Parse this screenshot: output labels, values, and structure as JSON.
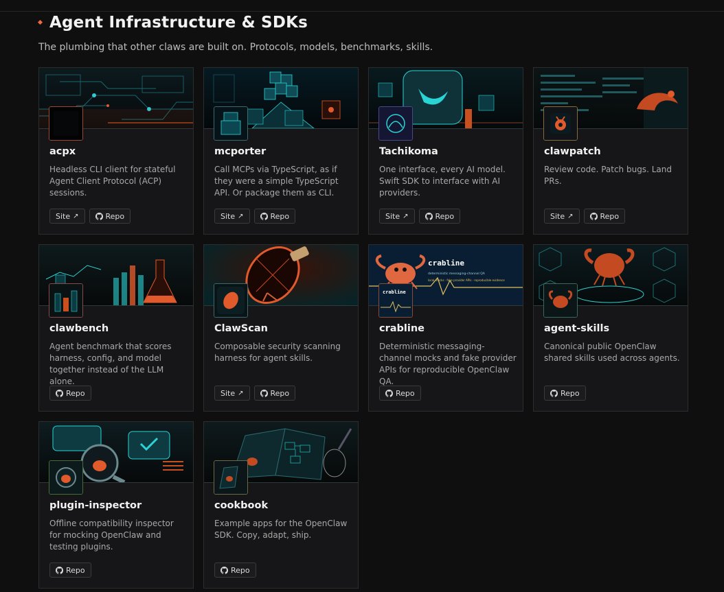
{
  "section": {
    "title": "Agent Infrastructure & SDKs",
    "subtitle": "The plumbing that other claws are built on. Protocols, models, benchmarks, skills."
  },
  "labels": {
    "site": "Site",
    "repo": "Repo"
  },
  "icons": {
    "site": "external-arrow-icon",
    "repo": "github-icon",
    "section": "diamond-icon"
  },
  "colors": {
    "background": "#0f0f10",
    "card": "#161618",
    "accent": "#f06a3c",
    "teal": "#2ad4d4"
  },
  "cards": [
    {
      "id": "acpx",
      "name": "acpx",
      "description": "Headless CLI client for stateful Agent Client Protocol (ACP) sessions.",
      "links": [
        "site",
        "repo"
      ]
    },
    {
      "id": "mcporter",
      "name": "mcporter",
      "description": "Call MCPs via TypeScript, as if they were a simple TypeScript API. Or package them as CLI.",
      "links": [
        "site",
        "repo"
      ]
    },
    {
      "id": "tachikoma",
      "name": "Tachikoma",
      "description": "One interface, every AI model. Swift SDK to interface with AI providers.",
      "links": [
        "site",
        "repo"
      ]
    },
    {
      "id": "clawpatch",
      "name": "clawpatch",
      "description": "Review code. Patch bugs. Land PRs.",
      "links": [
        "site",
        "repo"
      ]
    },
    {
      "id": "clawbench",
      "name": "clawbench",
      "description": "Agent benchmark that scores harness, config, and model together instead of the LLM alone.",
      "links": [
        "repo"
      ]
    },
    {
      "id": "clawscan",
      "name": "ClawScan",
      "description": "Composable security scanning harness for agent skills.",
      "links": [
        "site",
        "repo"
      ]
    },
    {
      "id": "crabline",
      "name": "crabline",
      "description": "Deterministic messaging-channel mocks and fake provider APIs for reproducible OpenClaw QA.",
      "links": [
        "repo"
      ],
      "banner_text": {
        "title": "crabline",
        "line1": "deterministic messaging-channel QA",
        "line2": "local mocks · fake provider APIs · reproducible evidence"
      }
    },
    {
      "id": "agent-skills",
      "name": "agent-skills",
      "description": "Canonical public OpenClaw shared skills used across agents.",
      "links": [
        "repo"
      ]
    },
    {
      "id": "plugin-inspector",
      "name": "plugin-inspector",
      "description": "Offline compatibility inspector for mocking OpenClaw and testing plugins.",
      "links": [
        "repo"
      ]
    },
    {
      "id": "cookbook",
      "name": "cookbook",
      "description": "Example apps for the OpenClaw SDK. Copy, adapt, ship.",
      "links": [
        "repo"
      ]
    }
  ]
}
